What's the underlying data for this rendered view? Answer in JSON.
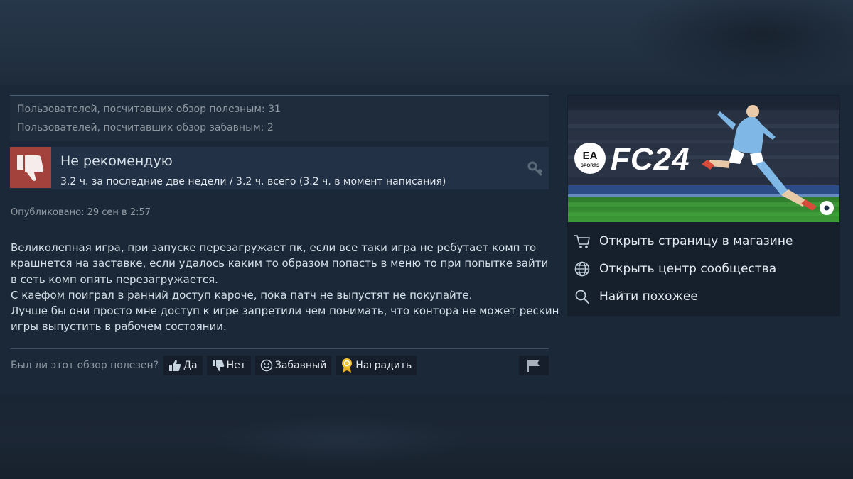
{
  "review": {
    "stats": {
      "helpful_text": "Пользователей, посчитавших обзор полезным: 31",
      "funny_text": "Пользователей, посчитавших обзор забавным: 2"
    },
    "recommendation": {
      "verdict": "Не рекомендую",
      "hours": "3.2 ч. за последние две недели / 3.2 ч. всего (3.2 ч. в момент написания)",
      "icon": "thumbs-down-icon",
      "badge_color": "#a3413c"
    },
    "posted": "Опубликовано: 29 сен в 2:57",
    "body_lines": [
      "Великолепная игра, при запуске перезагружает пк, если все таки игра не ребутает комп то",
      "крашнется на заставке, если удалось каким то образом попасть в меню то при попытке зайти",
      "в сеть комп опять перезагружается.",
      "С каефом поиграл в ранний доступ кароче, пока патч не выпустят не покупайте.",
      "Лучше бы они просто мне доступ к игре запретили чем понимать, что контора не может рескин",
      "игры выпустить в рабочем состоянии."
    ],
    "vote": {
      "question": "Был ли этот обзор полезен?",
      "yes": "Да",
      "no": "Нет",
      "funny": "Забавный",
      "award": "Наградить"
    }
  },
  "sidebar": {
    "capsule": {
      "publisher_line1": "EA",
      "publisher_line2": "SPORTS",
      "title": "FC24"
    },
    "links": [
      {
        "label": "Открыть страницу в магазине",
        "icon": "cart-icon"
      },
      {
        "label": "Открыть центр сообщества",
        "icon": "globe-icon"
      },
      {
        "label": "Найти похожее",
        "icon": "search-icon"
      }
    ]
  },
  "colors": {
    "background": "#1b2838",
    "panel": "#16202d",
    "negative": "#a3413c",
    "text": "#d6e0e8",
    "muted": "#8f98a0"
  }
}
